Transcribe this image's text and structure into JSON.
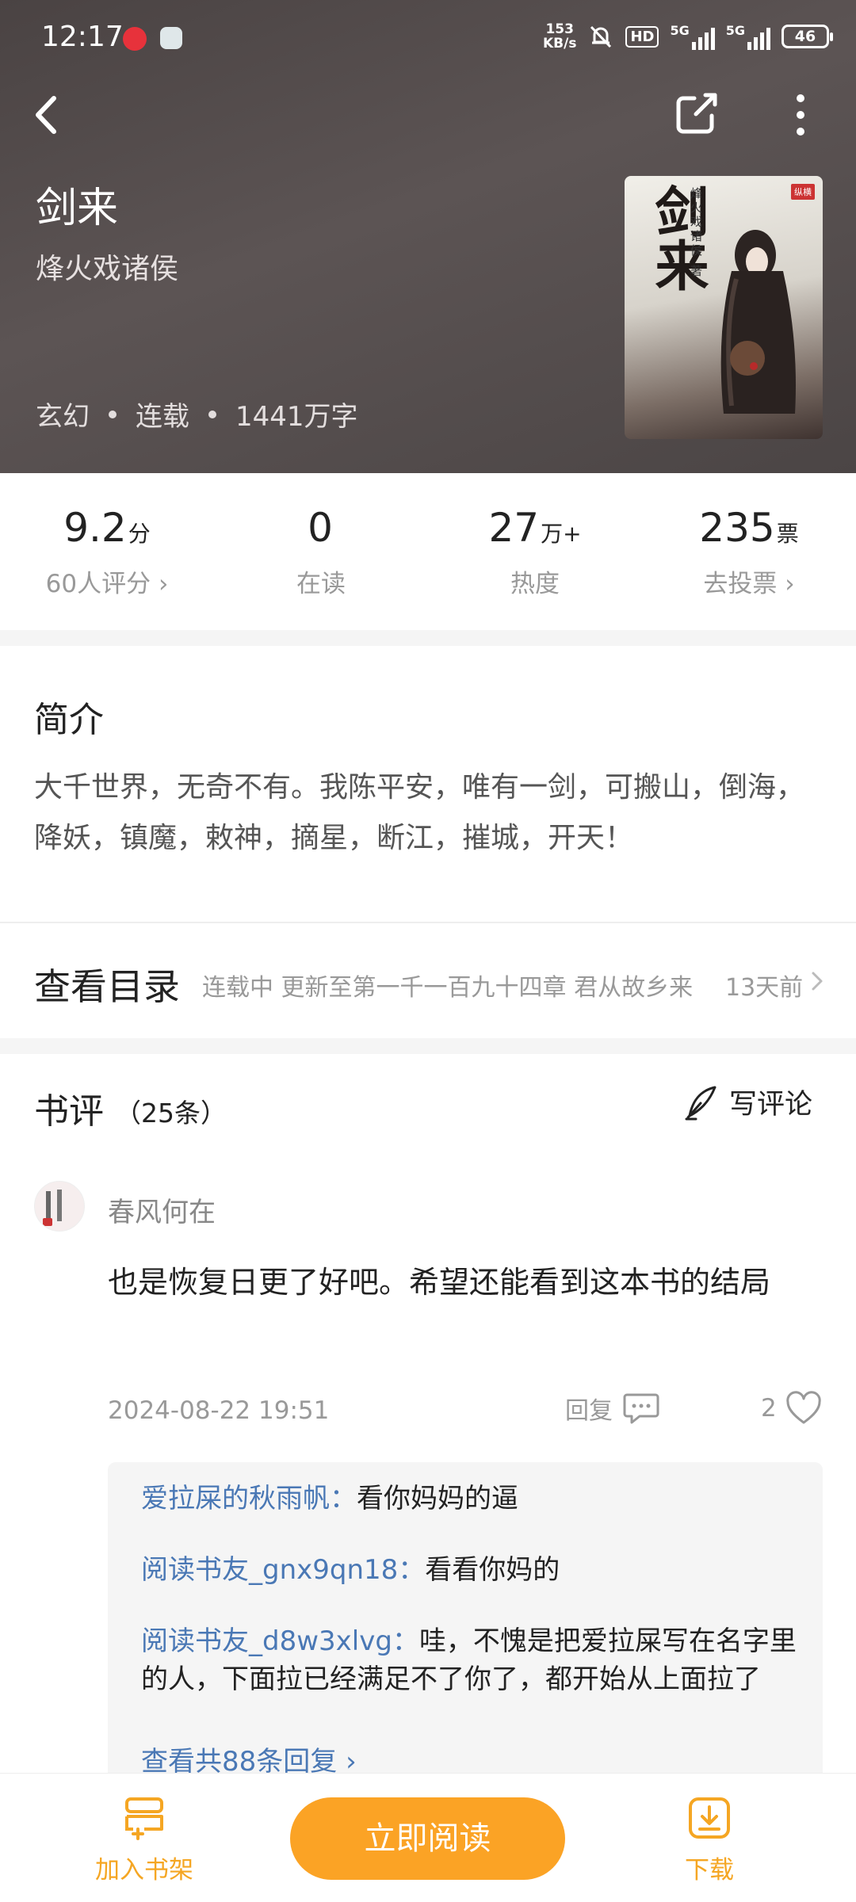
{
  "status_bar": {
    "time": "12:17",
    "net_speed": "153",
    "net_unit": "KB/s",
    "hd": "HD",
    "net1": "5G",
    "net2": "5G",
    "battery": "46"
  },
  "book": {
    "title": "剑来",
    "author": "烽火戏诸侯",
    "genre": "玄幻",
    "status": "连载",
    "word_count": "1441万字",
    "cover": {
      "title": "剑来",
      "author_text": "烽火戏诸侯 著",
      "publisher_tag": "纵横"
    }
  },
  "stats": [
    {
      "value": "9.2",
      "unit": "分",
      "label": "60人评分 ›"
    },
    {
      "value": "0",
      "unit": "",
      "label": "在读"
    },
    {
      "value": "27",
      "unit": "万+",
      "label": "热度"
    },
    {
      "value": "235",
      "unit": "票",
      "label": "去投票 ›"
    }
  ],
  "intro": {
    "heading": "简介",
    "text": "大千世界，无奇不有。我陈平安，唯有一剑，可搬山，倒海，降妖，镇魔，敕神，摘星，断江，摧城，开天！"
  },
  "catalog": {
    "heading": "查看目录",
    "update": "连载中 更新至第一千一百九十四章 君从故乡来",
    "time": "13天前"
  },
  "reviews": {
    "heading": "书评",
    "count": "（25条）",
    "write_label": "写评论",
    "items": [
      {
        "user": "春风何在",
        "text": "也是恢复日更了好吧。希望还能看到这本书的结局",
        "date": "2024-08-22 19:51",
        "reply_label": "回复",
        "likes": "2",
        "replies": [
          {
            "name": "爱拉屎的秋雨帆：",
            "text": "看你妈妈的逼"
          },
          {
            "name": "阅读书友_gnx9qn18：",
            "text": "看看你妈的"
          },
          {
            "name": "阅读书友_d8w3xlvg：",
            "text": "哇，不愧是把爱拉屎写在名字里的人，下面拉已经满足不了你了，都开始从上面拉了"
          }
        ],
        "view_all": "查看共88条回复 ›"
      }
    ]
  },
  "bottom_bar": {
    "shelf_label": "加入书架",
    "read_label": "立即阅读",
    "download_label": "下载"
  },
  "colors": {
    "accent": "#fba325",
    "link": "#4a78b5",
    "header_bg": "#524a4a"
  }
}
